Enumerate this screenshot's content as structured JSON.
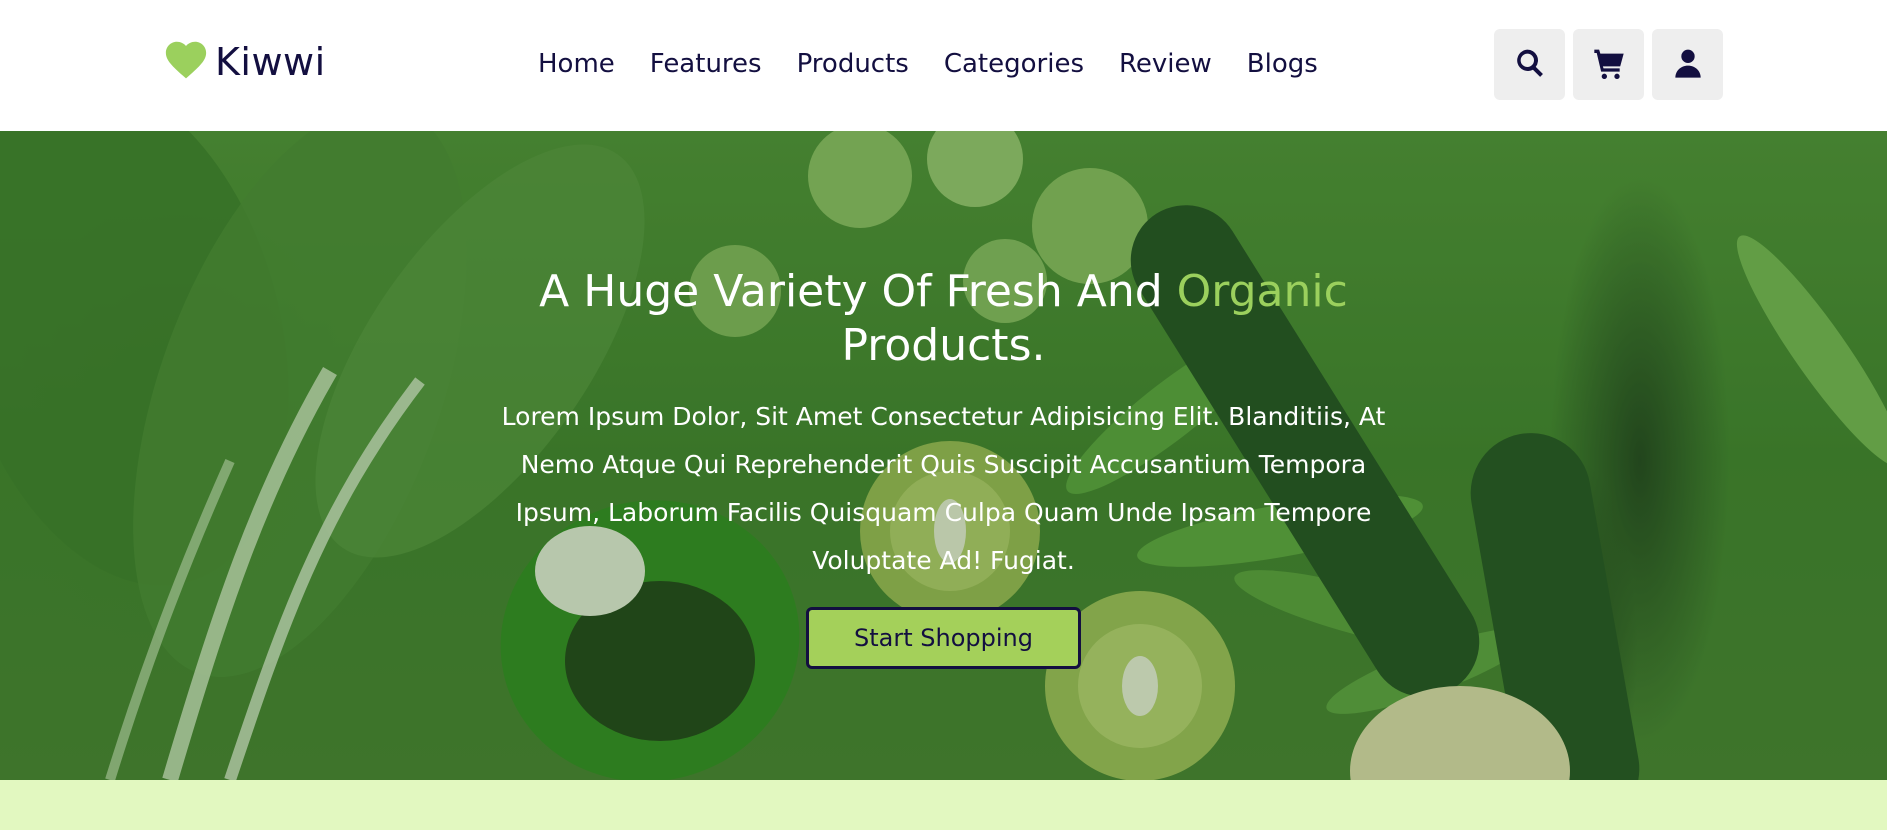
{
  "brand": {
    "name": "Kiwwi",
    "logo_icon": "heart-icon",
    "accent_color": "#9bd05d"
  },
  "nav": {
    "items": [
      {
        "label": "Home"
      },
      {
        "label": "Features"
      },
      {
        "label": "Products"
      },
      {
        "label": "Categories"
      },
      {
        "label": "Review"
      },
      {
        "label": "Blogs"
      }
    ]
  },
  "header_icons": [
    {
      "name": "search-icon"
    },
    {
      "name": "cart-icon"
    },
    {
      "name": "user-icon"
    }
  ],
  "hero": {
    "title_part1": "A Huge Variety Of Fresh And",
    "title_accent": "Organic",
    "title_part2": "Products.",
    "description": "Lorem Ipsum Dolor, Sit Amet Consectetur Adipisicing Elit. Blanditiis, At Nemo Atque Qui Reprehenderit Quis Suscipit Accusantium Tempora Ipsum, Laborum Facilis Quisquam Culpa Quam Unde Ipsam Tempore Voluptate Ad! Fugiat.",
    "button_label": "Start Shopping",
    "button_color": "#a4d05a",
    "text_color": "#130f40"
  },
  "colors": {
    "text_dark": "#130f40",
    "icon_bg": "#eeeeee",
    "bottom_strip": "#e2f8c0"
  }
}
